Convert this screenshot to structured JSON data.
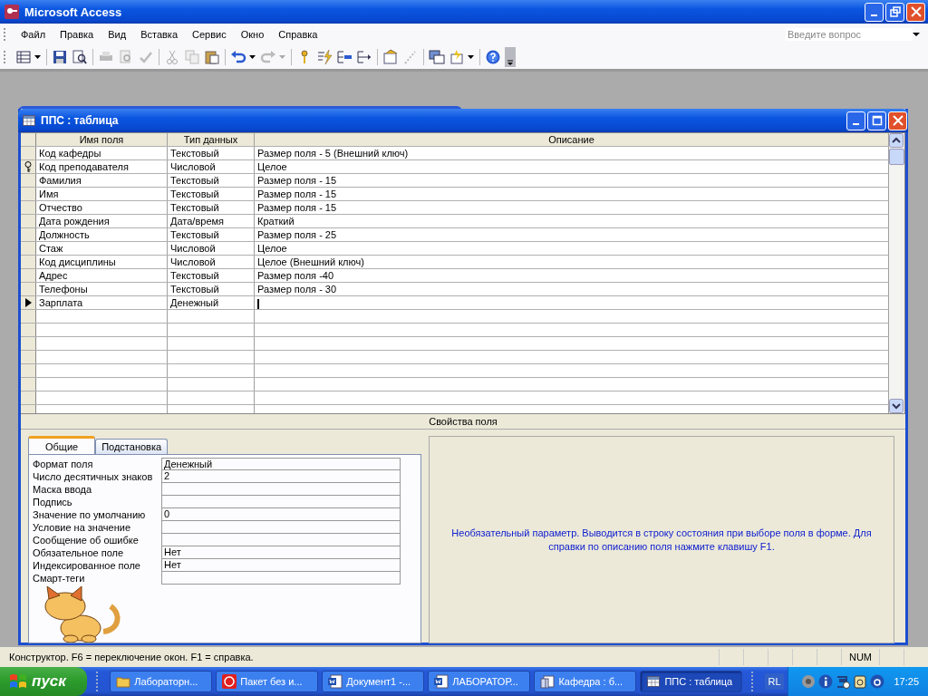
{
  "window": {
    "title": "Microsoft Access"
  },
  "menu": [
    {
      "label": "Файл"
    },
    {
      "label": "Правка"
    },
    {
      "label": "Вид"
    },
    {
      "label": "Вставка"
    },
    {
      "label": "Сервис"
    },
    {
      "label": "Окно"
    },
    {
      "label": "Справка"
    }
  ],
  "help_search": {
    "placeholder": "Введите вопрос"
  },
  "table_window": {
    "title": "ППС : таблица",
    "columns": [
      "Имя поля",
      "Тип данных",
      "Описание"
    ],
    "rows": [
      {
        "name": "Код кафедры",
        "type": "Текстовый",
        "description": "Размер поля - 5 (Внешний ключ)",
        "primary_key": false,
        "selected": false
      },
      {
        "name": "Код преподавателя",
        "type": "Числовой",
        "description": "Целое",
        "primary_key": true,
        "selected": false
      },
      {
        "name": "Фамилия",
        "type": "Текстовый",
        "description": "Размер поля - 15",
        "primary_key": false,
        "selected": false
      },
      {
        "name": "Имя",
        "type": "Текстовый",
        "description": "Размер поля - 15",
        "primary_key": false,
        "selected": false
      },
      {
        "name": "Отчество",
        "type": "Текстовый",
        "description": "Размер поля - 15",
        "primary_key": false,
        "selected": false
      },
      {
        "name": "Дата рождения",
        "type": "Дата/время",
        "description": "Краткий",
        "primary_key": false,
        "selected": false
      },
      {
        "name": "Должность",
        "type": "Текстовый",
        "description": "Размер поля - 25",
        "primary_key": false,
        "selected": false
      },
      {
        "name": "Стаж",
        "type": "Числовой",
        "description": "Целое",
        "primary_key": false,
        "selected": false
      },
      {
        "name": "Код дисциплины",
        "type": "Числовой",
        "description": "Целое  (Внешний ключ)",
        "primary_key": false,
        "selected": false
      },
      {
        "name": "Адрес",
        "type": "Текстовый",
        "description": "Размер поля -40",
        "primary_key": false,
        "selected": false
      },
      {
        "name": "Телефоны",
        "type": "Текстовый",
        "description": "Размер поля - 30",
        "primary_key": false,
        "selected": false
      },
      {
        "name": "Зарплата",
        "type": "Денежный",
        "primary_key": false,
        "selected": true
      }
    ],
    "properties_caption": "Свойства поля",
    "tabs": [
      {
        "label": "Общие",
        "selected": true
      },
      {
        "label": "Подстановка",
        "selected": false
      }
    ],
    "properties": [
      {
        "label": "Формат поля",
        "value": "Денежный"
      },
      {
        "label": "Число десятичных знаков",
        "value": "2"
      },
      {
        "label": "Маска ввода"
      },
      {
        "label": "Подпись"
      },
      {
        "label": "Значение по умолчанию",
        "value": "0"
      },
      {
        "label": "Условие на значение"
      },
      {
        "label": "Сообщение об ошибке"
      },
      {
        "label": "Обязательное поле",
        "value": "Нет"
      },
      {
        "label": "Индексированное поле",
        "value": "Нет"
      },
      {
        "label": "Смарт-теги"
      }
    ],
    "help_text": "Необязательный параметр.  Выводится в строку состояния при выборе поля в форме.  Для справки по описанию поля нажмите клавишу F1."
  },
  "status_bar": {
    "text": "Конструктор.  F6 = переключение окон.  F1 = справка.",
    "indicator": "NUM"
  },
  "taskbar": {
    "start": "пуск",
    "buttons": [
      {
        "label": "Лабораторн...",
        "kind": "folder",
        "selected": false
      },
      {
        "label": "Пакет без и...",
        "kind": "app",
        "selected": false
      },
      {
        "label": "Документ1 -...",
        "kind": "word",
        "selected": false
      },
      {
        "label": "ЛАБОРАТОР...",
        "kind": "word",
        "selected": false
      },
      {
        "label": "Кафедра : б...",
        "kind": "database",
        "selected": false
      },
      {
        "label": "ППС : таблица",
        "kind": "table",
        "selected": true
      }
    ],
    "language": "RL",
    "clock": "17:25"
  }
}
